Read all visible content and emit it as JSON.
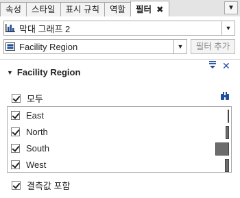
{
  "tabs": [
    {
      "label": "속성",
      "active": false
    },
    {
      "label": "스타일",
      "active": false
    },
    {
      "label": "표시 규칙",
      "active": false
    },
    {
      "label": "역할",
      "active": false
    },
    {
      "label": "필터",
      "active": true
    }
  ],
  "tab_close": "✖",
  "tabbar_dropdown": "▼",
  "object_selector": {
    "value": "막대 그래프 2",
    "icon": "bar-chart-icon"
  },
  "filter_selector": {
    "value": "Facility Region",
    "icon": "category-icon"
  },
  "add_filter_button": "필터 추가",
  "section": {
    "title": "Facility Region",
    "chevron": "▼",
    "menu_icon": "menu-icon",
    "remove_icon": "✕"
  },
  "select_all": {
    "label": "모두",
    "checked": true,
    "search_icon": "binoculars-icon"
  },
  "items": [
    {
      "label": "East",
      "checked": true,
      "frequency": 0.08
    },
    {
      "label": "North",
      "checked": true,
      "frequency": 0.25
    },
    {
      "label": "South",
      "checked": true,
      "frequency": 1.0
    },
    {
      "label": "West",
      "checked": true,
      "frequency": 0.28
    }
  ],
  "include_missing": {
    "label": "결측값 포함",
    "checked": true
  },
  "colors": {
    "accent": "#1f4e9c",
    "bar": "#6c6c6c"
  }
}
